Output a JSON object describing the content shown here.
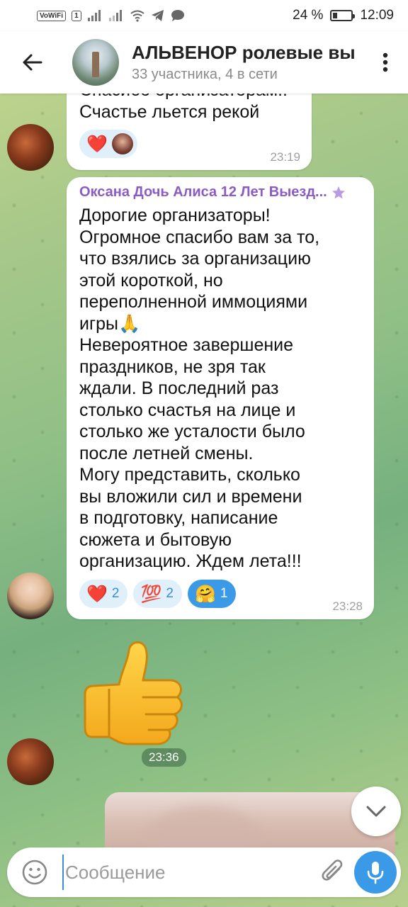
{
  "status_bar": {
    "network_badge": "VoWiFi",
    "sim_badge": "1",
    "battery": "24 %",
    "battery_level": 0.24,
    "time": "12:09"
  },
  "header": {
    "title": "АЛЬВЕНОР ролевые вы",
    "subtitle": "33 участника, 4 в сети"
  },
  "messages": [
    {
      "text": "Спасибо организаторам!!\nСчастье льется рекой",
      "time": "23:19",
      "reactions": [
        {
          "emoji": "❤️",
          "count": ""
        }
      ]
    },
    {
      "sender": "Оксана Дочь Алиса 12 Лет Выезд...",
      "text": "Дорогие организаторы!\nОгромное спасибо вам за то,\nчто взялись за организацию\nэтой короткой, но\nпереполненной иммоциями\nигры🙏\nНевероятное завершение\nпраздников, не зря так\nждали. В последний раз\nстолько счастья на лице и\nстолько же усталости было\nпосле летней смены.\nМогу представить, сколько\nвы вложили сил и времени\nв подготовку, написание\nсюжета и бытовую\nорганизацию. Ждем лета!!!",
      "time": "23:28",
      "reactions": [
        {
          "emoji": "❤️",
          "count": "2"
        },
        {
          "emoji": "💯",
          "count": "2"
        },
        {
          "emoji": "🤗",
          "count": "1"
        }
      ]
    },
    {
      "sticker": "thumbs-up",
      "time": "23:36"
    }
  ],
  "input": {
    "placeholder": "Сообщение"
  },
  "colors": {
    "accent": "#3a9ae8",
    "sender_name": "#8a5cc4",
    "bubble": "#ffffff"
  }
}
